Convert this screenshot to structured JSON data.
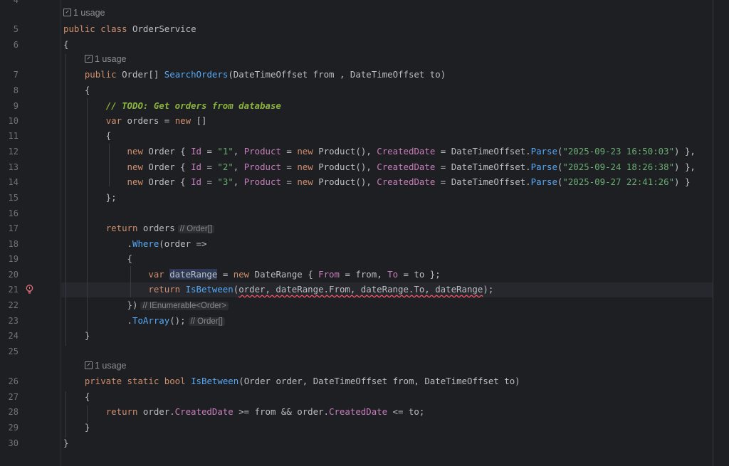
{
  "editor": {
    "usage_hint": "1 usage",
    "line_numbers": [
      "4",
      "5",
      "6",
      "7",
      "8",
      "9",
      "10",
      "11",
      "12",
      "13",
      "14",
      "15",
      "16",
      "17",
      "18",
      "19",
      "20",
      "21",
      "22",
      "23",
      "24",
      "25",
      "26",
      "27",
      "28",
      "29",
      "30"
    ],
    "inlay_hints": {
      "orders_type": "// Order[]",
      "where_type": "// IEnumerable<Order>",
      "toarray_type": "// Order[]"
    },
    "code": {
      "l5": [
        [
          "kw",
          "public"
        ],
        [
          "pl",
          " "
        ],
        [
          "kw",
          "class"
        ],
        [
          "pl",
          " "
        ],
        [
          "cl",
          "OrderService"
        ]
      ],
      "l6": [
        [
          "pl",
          "{"
        ]
      ],
      "l7": [
        [
          "pl",
          "    "
        ],
        [
          "kw",
          "public"
        ],
        [
          "pl",
          " "
        ],
        [
          "cl",
          "Order"
        ],
        [
          "pl",
          "[] "
        ],
        [
          "fn",
          "SearchOrders"
        ],
        [
          "pl",
          "("
        ],
        [
          "cl",
          "DateTimeOffset"
        ],
        [
          "pl",
          " from , "
        ],
        [
          "cl",
          "DateTimeOffset"
        ],
        [
          "pl",
          " to)"
        ]
      ],
      "l8": [
        [
          "pl",
          "    {"
        ]
      ],
      "l9": [
        [
          "pl",
          "        "
        ],
        [
          "todo",
          "// TODO: Get orders from database"
        ]
      ],
      "l10": [
        [
          "pl",
          "        "
        ],
        [
          "kw",
          "var"
        ],
        [
          "pl",
          " orders = "
        ],
        [
          "kw",
          "new"
        ],
        [
          "pl",
          " []"
        ]
      ],
      "l11": [
        [
          "pl",
          "        {"
        ]
      ],
      "l12": [
        [
          "pl",
          "            "
        ],
        [
          "kw",
          "new"
        ],
        [
          "pl",
          " "
        ],
        [
          "cl",
          "Order"
        ],
        [
          "pl",
          " { "
        ],
        [
          "prop",
          "Id"
        ],
        [
          "pl",
          " = "
        ],
        [
          "str",
          "\"1\""
        ],
        [
          "pl",
          ", "
        ],
        [
          "prop",
          "Product"
        ],
        [
          "pl",
          " = "
        ],
        [
          "kw",
          "new"
        ],
        [
          "pl",
          " "
        ],
        [
          "cl",
          "Product"
        ],
        [
          "pl",
          "(), "
        ],
        [
          "prop",
          "CreatedDate"
        ],
        [
          "pl",
          " = "
        ],
        [
          "cl",
          "DateTimeOffset"
        ],
        [
          "pl",
          "."
        ],
        [
          "fn",
          "Parse"
        ],
        [
          "pl",
          "("
        ],
        [
          "str",
          "\"2025-09-23 16:50:03\""
        ],
        [
          "pl",
          ") },"
        ]
      ],
      "l13": [
        [
          "pl",
          "            "
        ],
        [
          "kw",
          "new"
        ],
        [
          "pl",
          " "
        ],
        [
          "cl",
          "Order"
        ],
        [
          "pl",
          " { "
        ],
        [
          "prop",
          "Id"
        ],
        [
          "pl",
          " = "
        ],
        [
          "str",
          "\"2\""
        ],
        [
          "pl",
          ", "
        ],
        [
          "prop",
          "Product"
        ],
        [
          "pl",
          " = "
        ],
        [
          "kw",
          "new"
        ],
        [
          "pl",
          " "
        ],
        [
          "cl",
          "Product"
        ],
        [
          "pl",
          "(), "
        ],
        [
          "prop",
          "CreatedDate"
        ],
        [
          "pl",
          " = "
        ],
        [
          "cl",
          "DateTimeOffset"
        ],
        [
          "pl",
          "."
        ],
        [
          "fn",
          "Parse"
        ],
        [
          "pl",
          "("
        ],
        [
          "str",
          "\"2025-09-24 18:26:38\""
        ],
        [
          "pl",
          ") },"
        ]
      ],
      "l14": [
        [
          "pl",
          "            "
        ],
        [
          "kw",
          "new"
        ],
        [
          "pl",
          " "
        ],
        [
          "cl",
          "Order"
        ],
        [
          "pl",
          " { "
        ],
        [
          "prop",
          "Id"
        ],
        [
          "pl",
          " = "
        ],
        [
          "str",
          "\"3\""
        ],
        [
          "pl",
          ", "
        ],
        [
          "prop",
          "Product"
        ],
        [
          "pl",
          " = "
        ],
        [
          "kw",
          "new"
        ],
        [
          "pl",
          " "
        ],
        [
          "cl",
          "Product"
        ],
        [
          "pl",
          "(), "
        ],
        [
          "prop",
          "CreatedDate"
        ],
        [
          "pl",
          " = "
        ],
        [
          "cl",
          "DateTimeOffset"
        ],
        [
          "pl",
          "."
        ],
        [
          "fn",
          "Parse"
        ],
        [
          "pl",
          "("
        ],
        [
          "str",
          "\"2025-09-27 22:41:26\""
        ],
        [
          "pl",
          ") }"
        ]
      ],
      "l15": [
        [
          "pl",
          "        };"
        ]
      ],
      "l16": [],
      "l17": [
        [
          "pl",
          "        "
        ],
        [
          "kw",
          "return"
        ],
        [
          "pl",
          " orders"
        ]
      ],
      "l18": [
        [
          "pl",
          "            ."
        ],
        [
          "fn",
          "Where"
        ],
        [
          "pl",
          "(order =>"
        ]
      ],
      "l19": [
        [
          "pl",
          "            {"
        ]
      ],
      "l20": [
        [
          "pl",
          "                "
        ],
        [
          "kw",
          "var"
        ],
        [
          "pl",
          " "
        ],
        [
          "hl",
          "dateRange"
        ],
        [
          "pl",
          " = "
        ],
        [
          "kw",
          "new"
        ],
        [
          "pl",
          " "
        ],
        [
          "cl",
          "DateRange"
        ],
        [
          "pl",
          " { "
        ],
        [
          "prop",
          "From"
        ],
        [
          "pl",
          " = from, "
        ],
        [
          "prop",
          "To"
        ],
        [
          "pl",
          " = to };"
        ]
      ],
      "l21": [
        [
          "pl",
          "                "
        ],
        [
          "kw",
          "return"
        ],
        [
          "pl",
          " "
        ],
        [
          "fn",
          "IsBetween"
        ],
        [
          "pl",
          "("
        ],
        [
          "sq",
          "order, dateRange.From, dateRange.To, dateRange"
        ],
        [
          "pl",
          ");"
        ]
      ],
      "l22": [
        [
          "pl",
          "            })"
        ]
      ],
      "l23": [
        [
          "pl",
          "            ."
        ],
        [
          "fn",
          "ToArray"
        ],
        [
          "pl",
          "();"
        ]
      ],
      "l24": [
        [
          "pl",
          "    }"
        ]
      ],
      "l25": [],
      "l26": [
        [
          "pl",
          "    "
        ],
        [
          "kw",
          "private"
        ],
        [
          "pl",
          " "
        ],
        [
          "kw",
          "static"
        ],
        [
          "pl",
          " "
        ],
        [
          "kw",
          "bool"
        ],
        [
          "pl",
          " "
        ],
        [
          "fn",
          "IsBetween"
        ],
        [
          "pl",
          "("
        ],
        [
          "cl",
          "Order"
        ],
        [
          "pl",
          " order, "
        ],
        [
          "cl",
          "DateTimeOffset"
        ],
        [
          "pl",
          " from, "
        ],
        [
          "cl",
          "DateTimeOffset"
        ],
        [
          "pl",
          " to)"
        ]
      ],
      "l27": [
        [
          "pl",
          "    {"
        ]
      ],
      "l28": [
        [
          "pl",
          "        "
        ],
        [
          "kw",
          "return"
        ],
        [
          "pl",
          " order."
        ],
        [
          "prop",
          "CreatedDate"
        ],
        [
          "pl",
          " >= from && order."
        ],
        [
          "prop",
          "CreatedDate"
        ],
        [
          "pl",
          " <= to;"
        ]
      ],
      "l29": [
        [
          "pl",
          "    }"
        ]
      ],
      "l30": [
        [
          "pl",
          "}"
        ]
      ]
    }
  },
  "colors": {
    "background": "#1e1f22",
    "keyword": "#cf8e6d",
    "function": "#56a8f5",
    "property": "#c77dbb",
    "string": "#6aab73",
    "todo": "#8bb33d",
    "error_underline": "#f75464"
  },
  "icons": {
    "usage": "external-link-icon",
    "intention": "lightbulb-error-icon"
  }
}
